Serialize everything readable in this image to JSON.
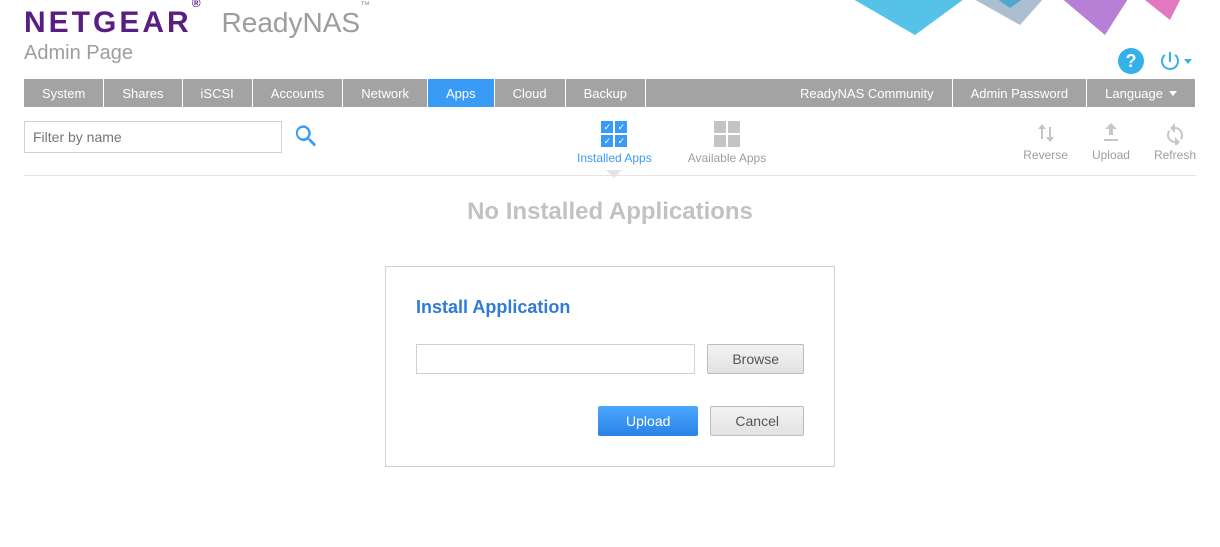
{
  "brand": "NETGEAR",
  "product": "ReadyNAS",
  "page_subtitle": "Admin Page",
  "top_icons": {
    "help": "?",
    "power": "power"
  },
  "nav": {
    "left": [
      {
        "id": "system",
        "label": "System"
      },
      {
        "id": "shares",
        "label": "Shares"
      },
      {
        "id": "iscsi",
        "label": "iSCSI"
      },
      {
        "id": "accounts",
        "label": "Accounts"
      },
      {
        "id": "network",
        "label": "Network"
      },
      {
        "id": "apps",
        "label": "Apps",
        "active": true
      },
      {
        "id": "cloud",
        "label": "Cloud"
      },
      {
        "id": "backup",
        "label": "Backup"
      }
    ],
    "right": [
      {
        "id": "community",
        "label": "ReadyNAS Community"
      },
      {
        "id": "adminpw",
        "label": "Admin Password"
      },
      {
        "id": "language",
        "label": "Language",
        "dropdown": true
      }
    ]
  },
  "filter": {
    "placeholder": "Filter by name"
  },
  "app_tabs": {
    "installed": {
      "label": "Installed Apps",
      "active": true,
      "check": "✓"
    },
    "available": {
      "label": "Available Apps"
    }
  },
  "actions": {
    "reverse": "Reverse",
    "upload": "Upload",
    "refresh": "Refresh"
  },
  "empty_message": "No Installed Applications",
  "modal": {
    "title": "Install Application",
    "file_value": "",
    "browse": "Browse",
    "upload": "Upload",
    "cancel": "Cancel"
  }
}
